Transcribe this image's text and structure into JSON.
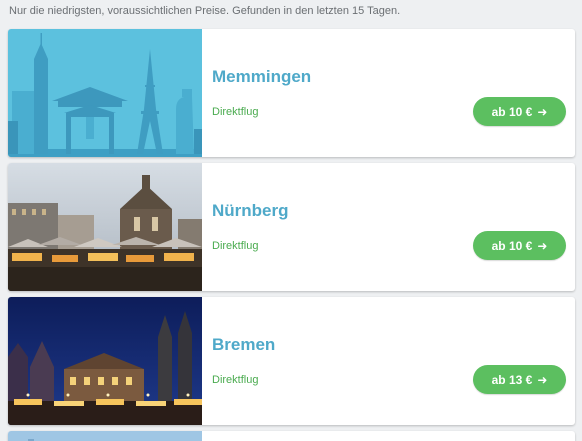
{
  "disclaimer": "Nur die niedrigsten, voraussichtlichen Preise. Gefunden in den letzten 15 Tagen.",
  "colors": {
    "city_text": "#4fa9c9",
    "flight_text": "#4aab4f",
    "price_button": "#5cbf60",
    "background": "#eef0f2"
  },
  "icons": {
    "price_arrow": "arrow-right-icon"
  },
  "destinations": [
    {
      "city": "Memmingen",
      "flight_type": "Direktflug",
      "price_label": "ab 10 €",
      "arrow": "➜"
    },
    {
      "city": "Nürnberg",
      "flight_type": "Direktflug",
      "price_label": "ab 10 €",
      "arrow": "➜"
    },
    {
      "city": "Bremen",
      "flight_type": "Direktflug",
      "price_label": "ab 13 €",
      "arrow": "➜"
    }
  ]
}
